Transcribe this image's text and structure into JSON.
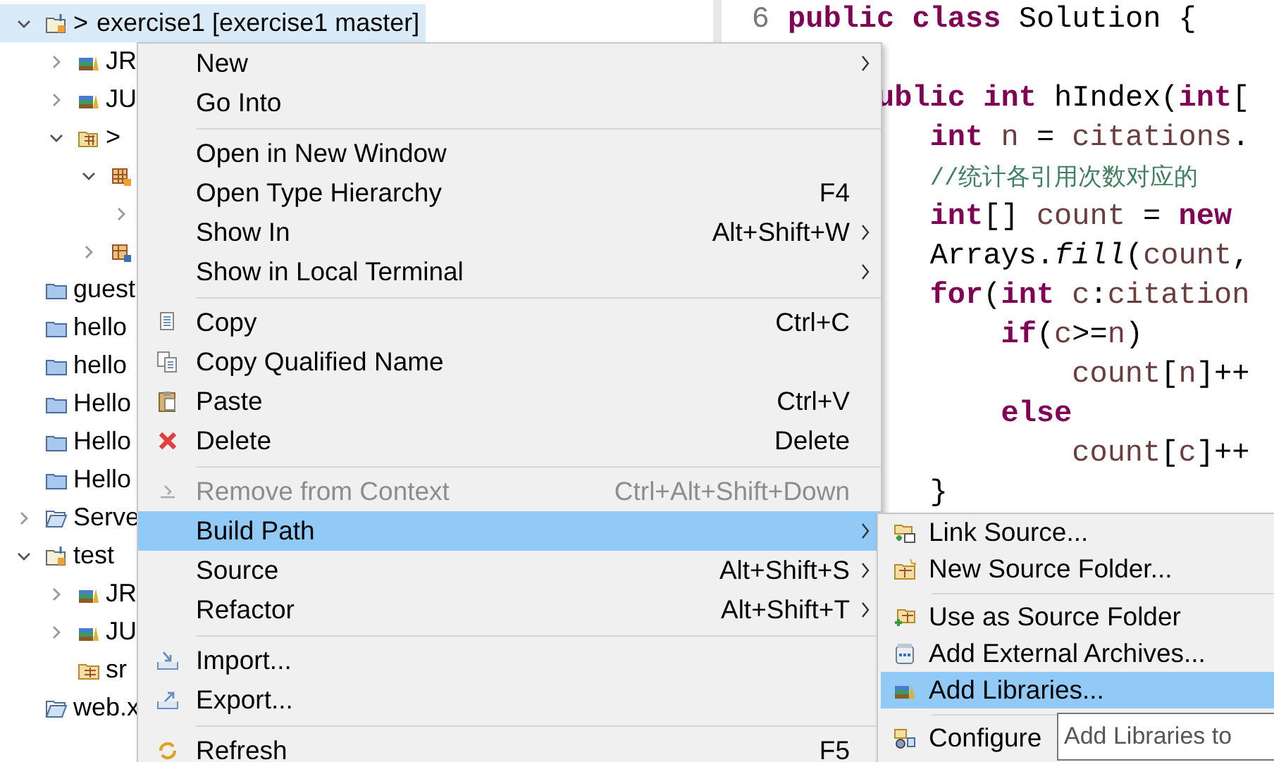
{
  "explorer": {
    "items": [
      {
        "label": "exercise1 [exercise1 master]",
        "prefix": ">",
        "kind": "project",
        "expanded": true,
        "selected": true,
        "children": [
          {
            "label": "JR",
            "kind": "library",
            "expanded": false,
            "selected": false
          },
          {
            "label": "JU",
            "kind": "library",
            "expanded": false,
            "selected": false
          },
          {
            "prefix": ">",
            "kind": "source-folder",
            "expanded": true,
            "selected": false,
            "children": [
              {
                "kind": "package",
                "expanded": true,
                "selected": false,
                "children": [
                  {
                    "expanded": false,
                    "selected": false
                  }
                ]
              },
              {
                "kind": "package-unknown",
                "expanded": false,
                "selected": false
              }
            ]
          }
        ]
      },
      {
        "label": "guest",
        "kind": "folder",
        "selected": false
      },
      {
        "label": "hello",
        "kind": "folder",
        "selected": false
      },
      {
        "label": "hello",
        "kind": "folder",
        "selected": false
      },
      {
        "label": "Hello",
        "kind": "folder",
        "selected": false
      },
      {
        "label": "Hello",
        "kind": "folder",
        "selected": false
      },
      {
        "label": "Hello",
        "kind": "folder",
        "selected": false
      },
      {
        "label": "Serve",
        "kind": "open-folder",
        "expanded": false,
        "selected": false
      },
      {
        "label": "test",
        "kind": "project",
        "expanded": true,
        "selected": false,
        "children": [
          {
            "label": "JR",
            "kind": "library",
            "expanded": false,
            "selected": false
          },
          {
            "label": "JU",
            "kind": "library",
            "expanded": false,
            "selected": false
          },
          {
            "label": "sr",
            "kind": "src",
            "selected": false
          }
        ]
      },
      {
        "label": "web.x",
        "kind": "open-folder",
        "selected": false
      }
    ]
  },
  "editor": {
    "line_numbers": [
      "6"
    ],
    "lines": [
      {
        "kind": "code",
        "tokens": [
          {
            "kind": "keyword",
            "text": "public"
          },
          {
            "kind": "keyword",
            "text": " class"
          },
          {
            "kind": "plain",
            "text": " Solution {"
          }
        ]
      },
      {
        "kind": "blank"
      },
      {
        "kind": "code",
        "tokens": [
          {
            "kind": "keyword",
            "text": "     ublic"
          },
          {
            "kind": "keyword",
            "text": " int"
          },
          {
            "kind": "plain",
            "text": " hIndex("
          },
          {
            "kind": "keyword",
            "text": "int"
          },
          {
            "kind": "plain",
            "text": "["
          }
        ]
      },
      {
        "kind": "code",
        "tokens": [
          {
            "kind": "keyword",
            "text": "        int"
          },
          {
            "kind": "variable",
            "text": " n"
          },
          {
            "kind": "plain",
            "text": " = "
          },
          {
            "kind": "variable",
            "text": "citations"
          },
          {
            "kind": "plain",
            "text": "."
          }
        ]
      },
      {
        "kind": "code",
        "tokens": [
          {
            "kind": "comment",
            "text": "        //统计各引用次数对应的"
          }
        ]
      },
      {
        "kind": "code",
        "tokens": [
          {
            "kind": "keyword",
            "text": "        int"
          },
          {
            "kind": "plain",
            "text": "[] "
          },
          {
            "kind": "variable",
            "text": "count"
          },
          {
            "kind": "plain",
            "text": " = "
          },
          {
            "kind": "keyword",
            "text": "new"
          }
        ]
      },
      {
        "kind": "code",
        "tokens": [
          {
            "kind": "plain",
            "text": "        Arrays."
          },
          {
            "kind": "static",
            "text": "fill"
          },
          {
            "kind": "plain",
            "text": "("
          },
          {
            "kind": "variable",
            "text": "count"
          },
          {
            "kind": "plain",
            "text": ","
          }
        ]
      },
      {
        "kind": "code",
        "tokens": [
          {
            "kind": "keyword",
            "text": "        for"
          },
          {
            "kind": "plain",
            "text": "("
          },
          {
            "kind": "keyword",
            "text": "int"
          },
          {
            "kind": "variable",
            "text": " c"
          },
          {
            "kind": "plain",
            "text": ":"
          },
          {
            "kind": "variable",
            "text": "citation"
          }
        ]
      },
      {
        "kind": "code",
        "tokens": [
          {
            "kind": "keyword",
            "text": "            if"
          },
          {
            "kind": "plain",
            "text": "("
          },
          {
            "kind": "variable",
            "text": "c"
          },
          {
            "kind": "plain",
            "text": ">="
          },
          {
            "kind": "variable",
            "text": "n"
          },
          {
            "kind": "plain",
            "text": ")"
          }
        ]
      },
      {
        "kind": "code",
        "tokens": [
          {
            "kind": "variable",
            "text": "                count"
          },
          {
            "kind": "plain",
            "text": "["
          },
          {
            "kind": "variable",
            "text": "n"
          },
          {
            "kind": "plain",
            "text": "]++"
          }
        ]
      },
      {
        "kind": "code",
        "tokens": [
          {
            "kind": "keyword",
            "text": "            else"
          }
        ]
      },
      {
        "kind": "code",
        "tokens": [
          {
            "kind": "variable",
            "text": "                count"
          },
          {
            "kind": "plain",
            "text": "["
          },
          {
            "kind": "variable",
            "text": "c"
          },
          {
            "kind": "plain",
            "text": "]++"
          }
        ]
      },
      {
        "kind": "code",
        "tokens": [
          {
            "kind": "plain",
            "text": "        }"
          }
        ]
      }
    ]
  },
  "context_menu": {
    "groups": [
      [
        {
          "label": "New",
          "submenu": true,
          "disabled": false,
          "selected": false
        },
        {
          "label": "Go Into",
          "submenu": false,
          "disabled": false,
          "selected": false
        }
      ],
      [
        {
          "label": "Open in New Window",
          "submenu": false,
          "disabled": false,
          "selected": false
        },
        {
          "label": "Open Type Hierarchy",
          "shortcut": "F4",
          "submenu": false,
          "disabled": false,
          "selected": false
        },
        {
          "label": "Show In",
          "shortcut": "Alt+Shift+W",
          "submenu": true,
          "disabled": false,
          "selected": false
        },
        {
          "label": "Show in Local Terminal",
          "submenu": true,
          "disabled": false,
          "selected": false
        }
      ],
      [
        {
          "label": "Copy",
          "kind": "copy",
          "shortcut": "Ctrl+C",
          "submenu": false,
          "disabled": false,
          "selected": false
        },
        {
          "label": "Copy Qualified Name",
          "kind": "copy-qualified",
          "submenu": false,
          "disabled": false,
          "selected": false
        },
        {
          "label": "Paste",
          "kind": "paste",
          "shortcut": "Ctrl+V",
          "submenu": false,
          "disabled": false,
          "selected": false
        },
        {
          "label": "Delete",
          "kind": "delete",
          "shortcut": "Delete",
          "submenu": false,
          "disabled": false,
          "selected": false
        }
      ],
      [
        {
          "label": "Remove from Context",
          "kind": "remove",
          "shortcut": "Ctrl+Alt+Shift+Down",
          "submenu": false,
          "disabled": true,
          "selected": false
        },
        {
          "label": "Build Path",
          "submenu": true,
          "disabled": false,
          "selected": true
        },
        {
          "label": "Source",
          "shortcut": "Alt+Shift+S",
          "submenu": true,
          "disabled": false,
          "selected": false
        },
        {
          "label": "Refactor",
          "shortcut": "Alt+Shift+T",
          "submenu": true,
          "disabled": false,
          "selected": false
        }
      ],
      [
        {
          "label": "Import...",
          "kind": "import",
          "submenu": false,
          "disabled": false,
          "selected": false
        },
        {
          "label": "Export...",
          "kind": "export",
          "submenu": false,
          "disabled": false,
          "selected": false
        }
      ],
      [
        {
          "label": "Refresh",
          "kind": "refresh",
          "shortcut": "F5",
          "submenu": false,
          "disabled": false,
          "selected": false
        }
      ]
    ]
  },
  "submenu": {
    "groups": [
      [
        {
          "label": "Link Source...",
          "kind": "link-source",
          "selected": false
        },
        {
          "label": "New Source Folder...",
          "kind": "new-source-folder",
          "selected": false
        }
      ],
      [
        {
          "label": "Use as Source Folder",
          "kind": "use-source-folder",
          "selected": false
        },
        {
          "label": "Add External Archives...",
          "kind": "archive",
          "selected": false
        },
        {
          "label": "Add Libraries...",
          "kind": "library",
          "selected": true
        }
      ],
      [
        {
          "label": "Configure",
          "kind": "configure",
          "selected": false
        }
      ]
    ]
  },
  "tooltip": {
    "text": "Add Libraries to"
  }
}
